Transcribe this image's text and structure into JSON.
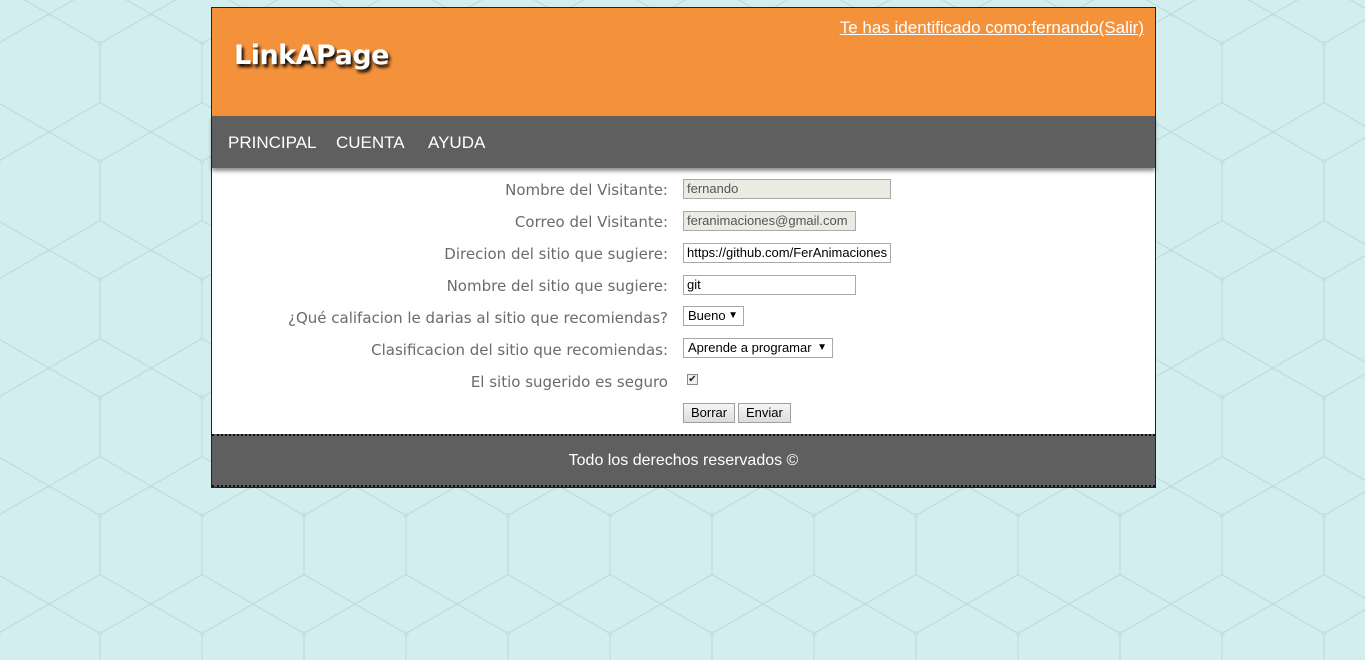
{
  "header": {
    "logo": "LinkAPage",
    "user_link": "Te has identificado como:fernando(Salir)"
  },
  "nav": {
    "items": [
      "PRINCIPAL",
      "CUENTA",
      "AYUDA"
    ]
  },
  "form": {
    "visitor_name_label": "Nombre del Visitante:",
    "visitor_name_value": "fernando",
    "visitor_email_label": "Correo del Visitante:",
    "visitor_email_value": "feranimaciones@gmail.com",
    "site_url_label": "Direcion del sitio que sugiere:",
    "site_url_value": "https://github.com/FerAnimaciones",
    "site_name_label": "Nombre del sitio que sugiere:",
    "site_name_value": "git",
    "rating_label": "¿Qué califacion le darias al sitio que recomiendas?",
    "rating_value": "Bueno",
    "category_label": "Clasificacion del sitio que recomiendas:",
    "category_value": "Aprende a programar",
    "safe_label": "El sitio sugerido es seguro",
    "safe_checked": "✔",
    "clear_button": "Borrar",
    "submit_button": "Enviar"
  },
  "footer": {
    "text": "Todo los derechos reservados ©"
  },
  "colors": {
    "background": "#d3eeee",
    "header": "#f4923c",
    "nav": "#5f5f5f",
    "footer": "#5f5f5f"
  }
}
